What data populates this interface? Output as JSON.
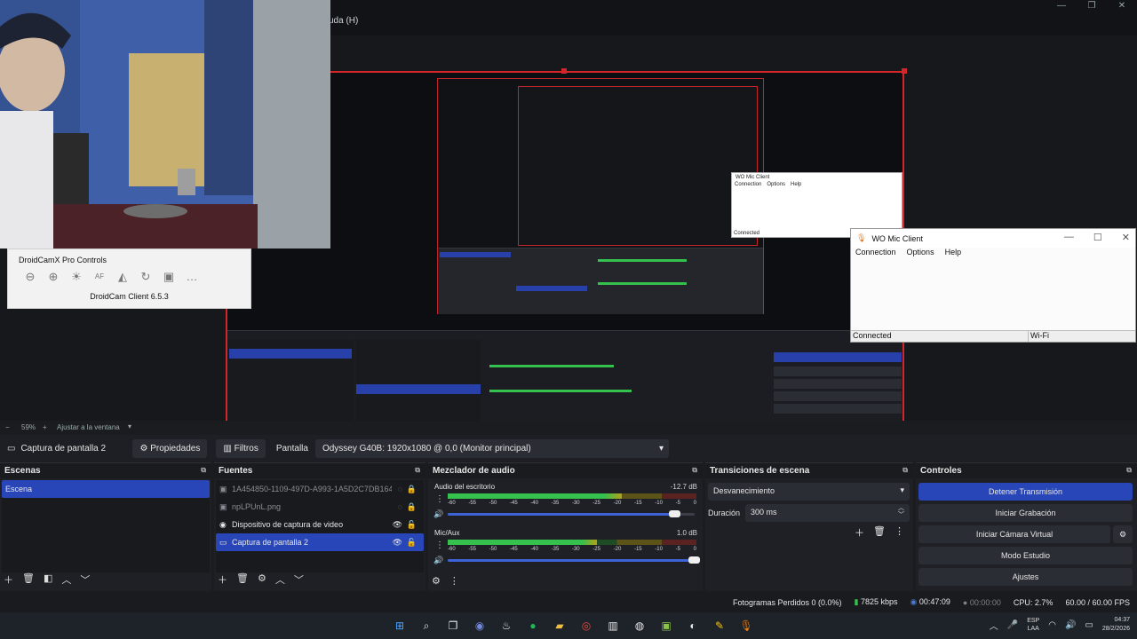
{
  "obs": {
    "menu_help": "uda (H)",
    "window_controls": [
      "—",
      "❐",
      "✕"
    ],
    "zoom": {
      "minus": "−",
      "value": "59%",
      "plus": "+",
      "fit": "Ajustar a la ventana",
      "caret": "▾"
    },
    "source_name": "Captura de pantalla 2",
    "properties_label": "Propiedades",
    "filters_label": "Filtros",
    "display_label": "Pantalla",
    "display_value": "Odyssey G40B: 1920x1080 @ 0,0 (Monitor principal)"
  },
  "scenes": {
    "title": "Escenas",
    "items": [
      "Escena"
    ]
  },
  "sources": {
    "title": "Fuentes",
    "items": [
      {
        "label": "1A454850-1109-497D-A993-1A5D2C7DB164.p",
        "icon": "image-icon",
        "dim": true
      },
      {
        "label": "npLPUnL.png",
        "icon": "image-icon",
        "dim": true
      },
      {
        "label": "Dispositivo de captura de video",
        "icon": "camera-icon",
        "dim": false
      },
      {
        "label": "Captura de pantalla 2",
        "icon": "monitor-icon",
        "dim": false
      }
    ]
  },
  "mixer": {
    "title": "Mezclador de audio",
    "ticks": [
      "-60",
      "-55",
      "-50",
      "-45",
      "-40",
      "-35",
      "-30",
      "-25",
      "-20",
      "-15",
      "-10",
      "-5",
      "0"
    ],
    "channels": [
      {
        "name": "Audio del escritorio",
        "db": "-12.7 dB",
        "level": 0.7,
        "volume": 0.92
      },
      {
        "name": "Mic/Aux",
        "db": "1.0 dB",
        "level": 0.6,
        "volume": 1.0
      }
    ]
  },
  "transitions": {
    "title": "Transiciones de escena",
    "type": "Desvanecimiento",
    "duration_label": "Duración",
    "duration_value": "300 ms"
  },
  "controls": {
    "title": "Controles",
    "buttons": [
      "Detener Transmisión",
      "Iniciar Grabación",
      "Iniciar Cámara Virtual",
      "Modo Estudio",
      "Ajustes"
    ]
  },
  "status": {
    "frames": "Fotogramas Perdidos 0 (0.0%)",
    "bitrate": "7825 kbps",
    "live_time": "00:47:09",
    "rec_time": "00:00:00",
    "cpu": "CPU: 2.7%",
    "fps": "60.00 / 60.00 FPS"
  },
  "droidcam": {
    "title": "DroidCamX Pro Controls",
    "version": "DroidCam Client 6.5.3",
    "tools": [
      "⊖",
      "⊕",
      "☀",
      "AF",
      "◭",
      "↻",
      "▣",
      "…"
    ]
  },
  "womic": {
    "title": "WO Mic Client",
    "menu": [
      "Connection",
      "Options",
      "Help"
    ],
    "status": "Connected",
    "mode": "Wi-Fi"
  },
  "womic_small": {
    "title": "WO Mic Client",
    "menu": [
      "Connection",
      "Options",
      "Help"
    ],
    "status": "Connected"
  },
  "tray": {
    "lang1": "ESP",
    "lang2": "LAA",
    "time": "04:37",
    "date": "28/2/2026"
  },
  "colors": {
    "accent": "#2846b8",
    "live_red": "#d2262b",
    "meter_green": "#35c14d",
    "meter_yellow": "#b5a019",
    "meter_red": "#b33030"
  }
}
